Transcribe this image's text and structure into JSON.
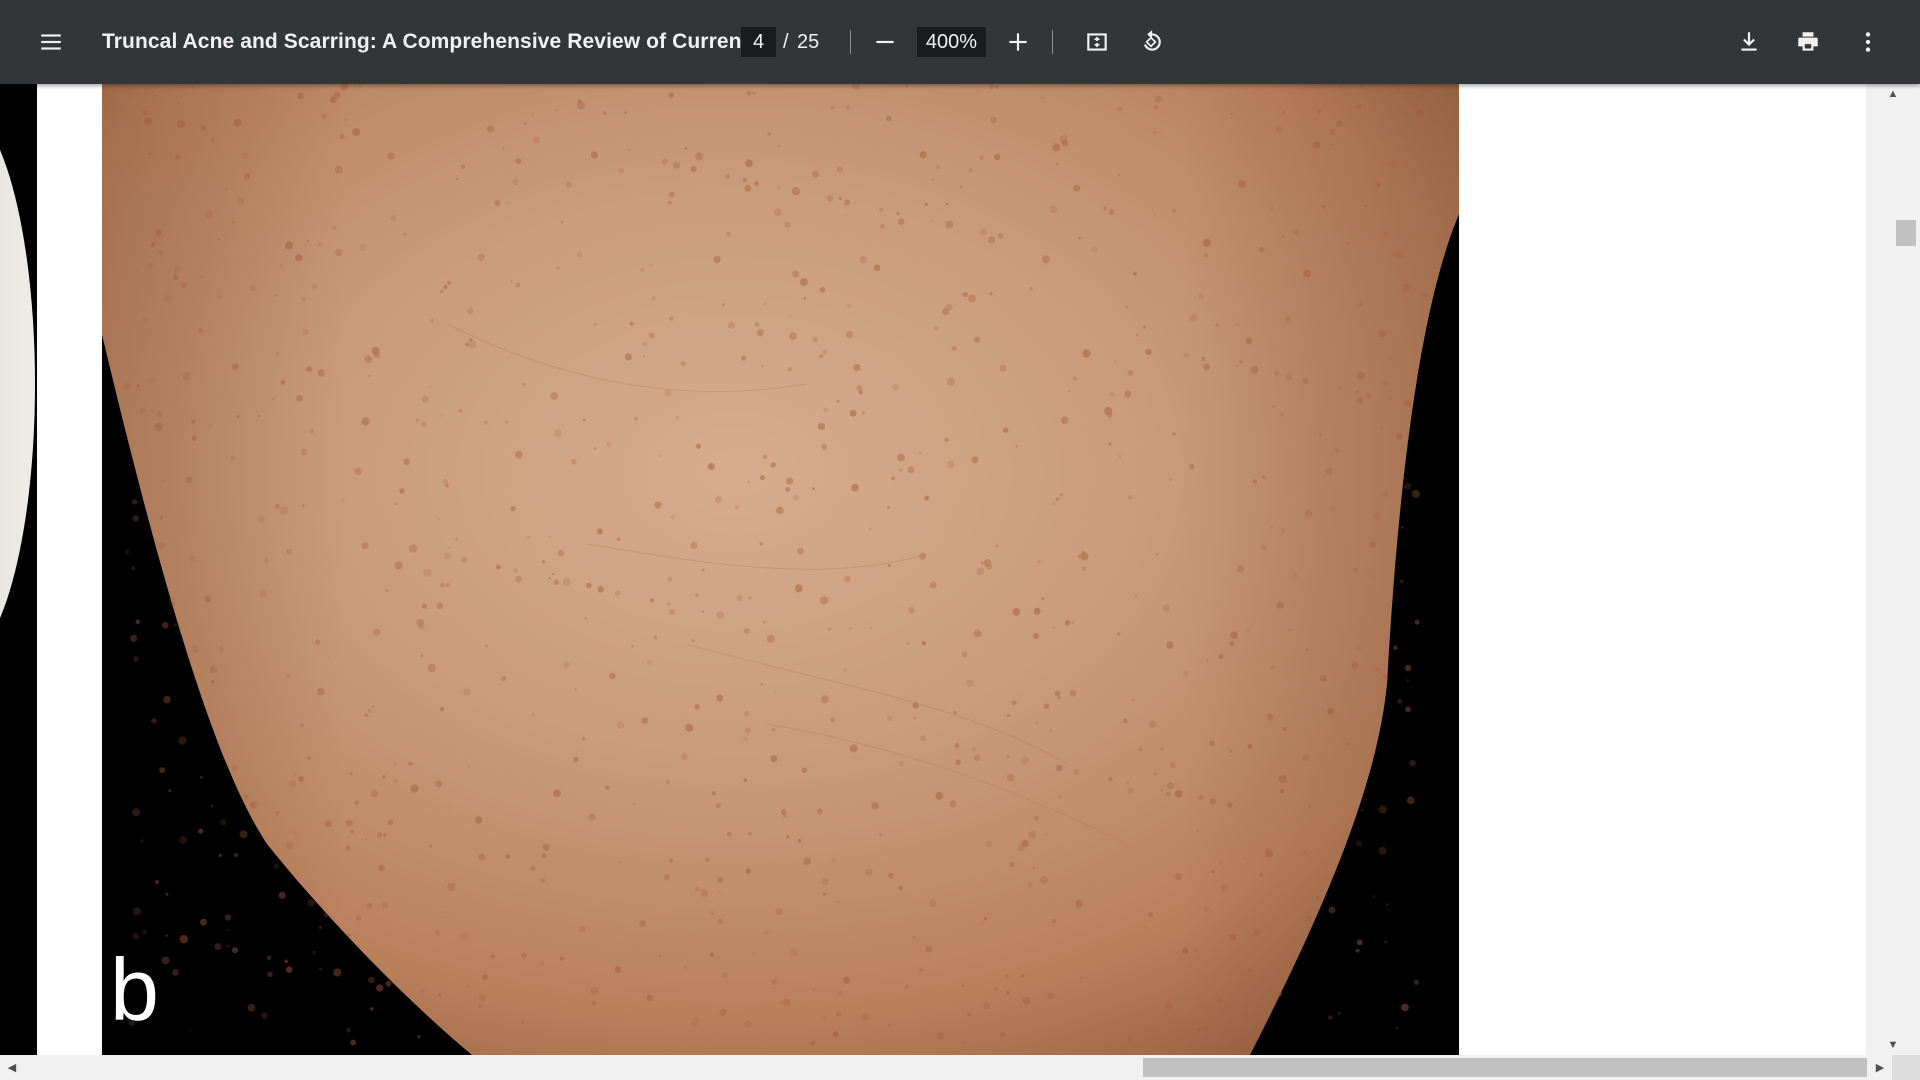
{
  "toolbar": {
    "menu_icon": "hamburger-menu-icon",
    "title": "Truncal Acne and Scarring: A Comprehensive Review of Current...",
    "page_current": "4",
    "page_separator": "/",
    "page_total": "25",
    "zoom_out_icon": "minus-icon",
    "zoom_value": "400%",
    "zoom_in_icon": "plus-icon",
    "fit_icon": "fit-to-page-icon",
    "rotate_icon": "rotate-counterclockwise-icon",
    "download_icon": "download-icon",
    "print_icon": "print-icon",
    "more_icon": "more-vertical-icon"
  },
  "document": {
    "figure_panel_letter": "b"
  },
  "scrollbars": {
    "vertical_position_fraction": 0.14,
    "horizontal_position_fraction": 0.62
  },
  "colors": {
    "toolbar_bg": "#323639",
    "viewer_bg": "#525659",
    "page_bg": "#ffffff",
    "skin_tone": "#c99a78"
  }
}
